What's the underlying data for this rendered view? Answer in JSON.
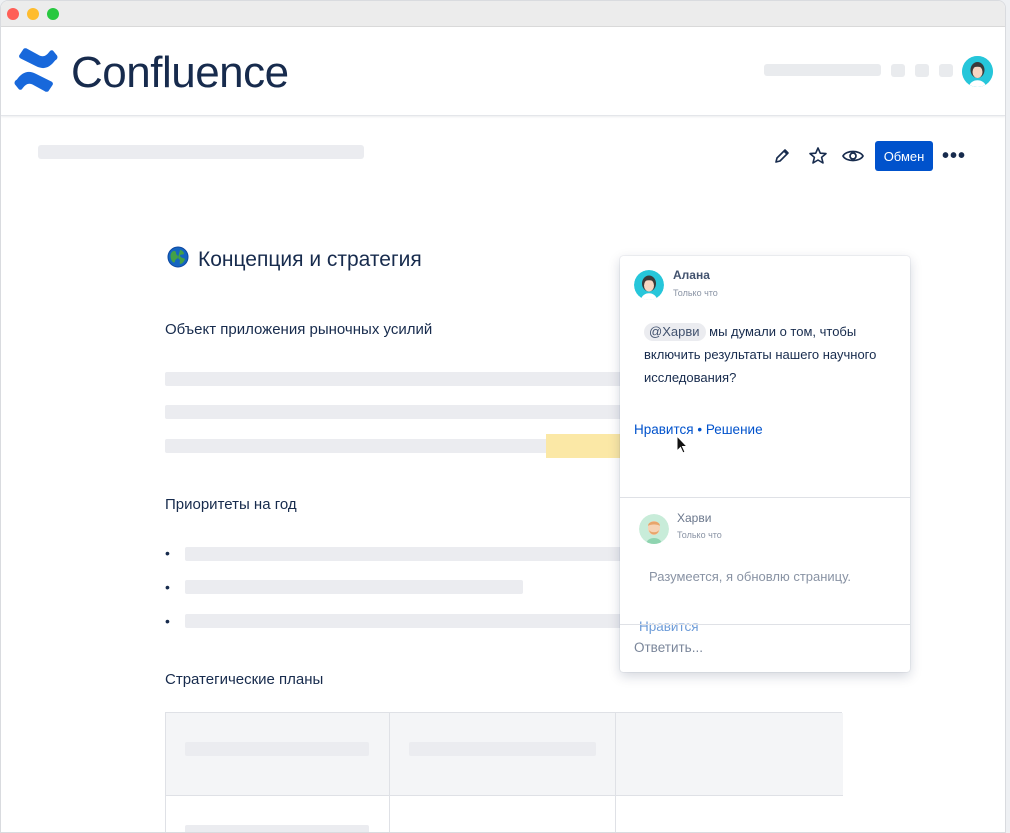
{
  "app": {
    "name": "Confluence",
    "brand_color": "#0052cc"
  },
  "toolbar": {
    "edit_icon": "pencil-icon",
    "star_icon": "star-icon",
    "watch_icon": "eye-icon",
    "share_label": "Обмен",
    "more_label": "•••"
  },
  "page": {
    "title": "Концепция и стратегия",
    "title_icon": "globe-icon",
    "sections": {
      "section1": "Объект приложения рыночных усилий",
      "section2": "Приоритеты на год",
      "section3": "Стратегические планы"
    },
    "bullet": "•"
  },
  "comment": {
    "author": "Алана",
    "time": "Только что",
    "mention": "@Харви",
    "text": "мы думали о том, чтобы включить результаты нашего научного исследования?",
    "like": "Нравится",
    "separator": " • ",
    "resolve": "Решение"
  },
  "reply": {
    "author": "Харви",
    "time": "Только что",
    "text": "Разумеется, я обновлю страницу.",
    "like": "Нравится",
    "input_placeholder": "Ответить..."
  }
}
